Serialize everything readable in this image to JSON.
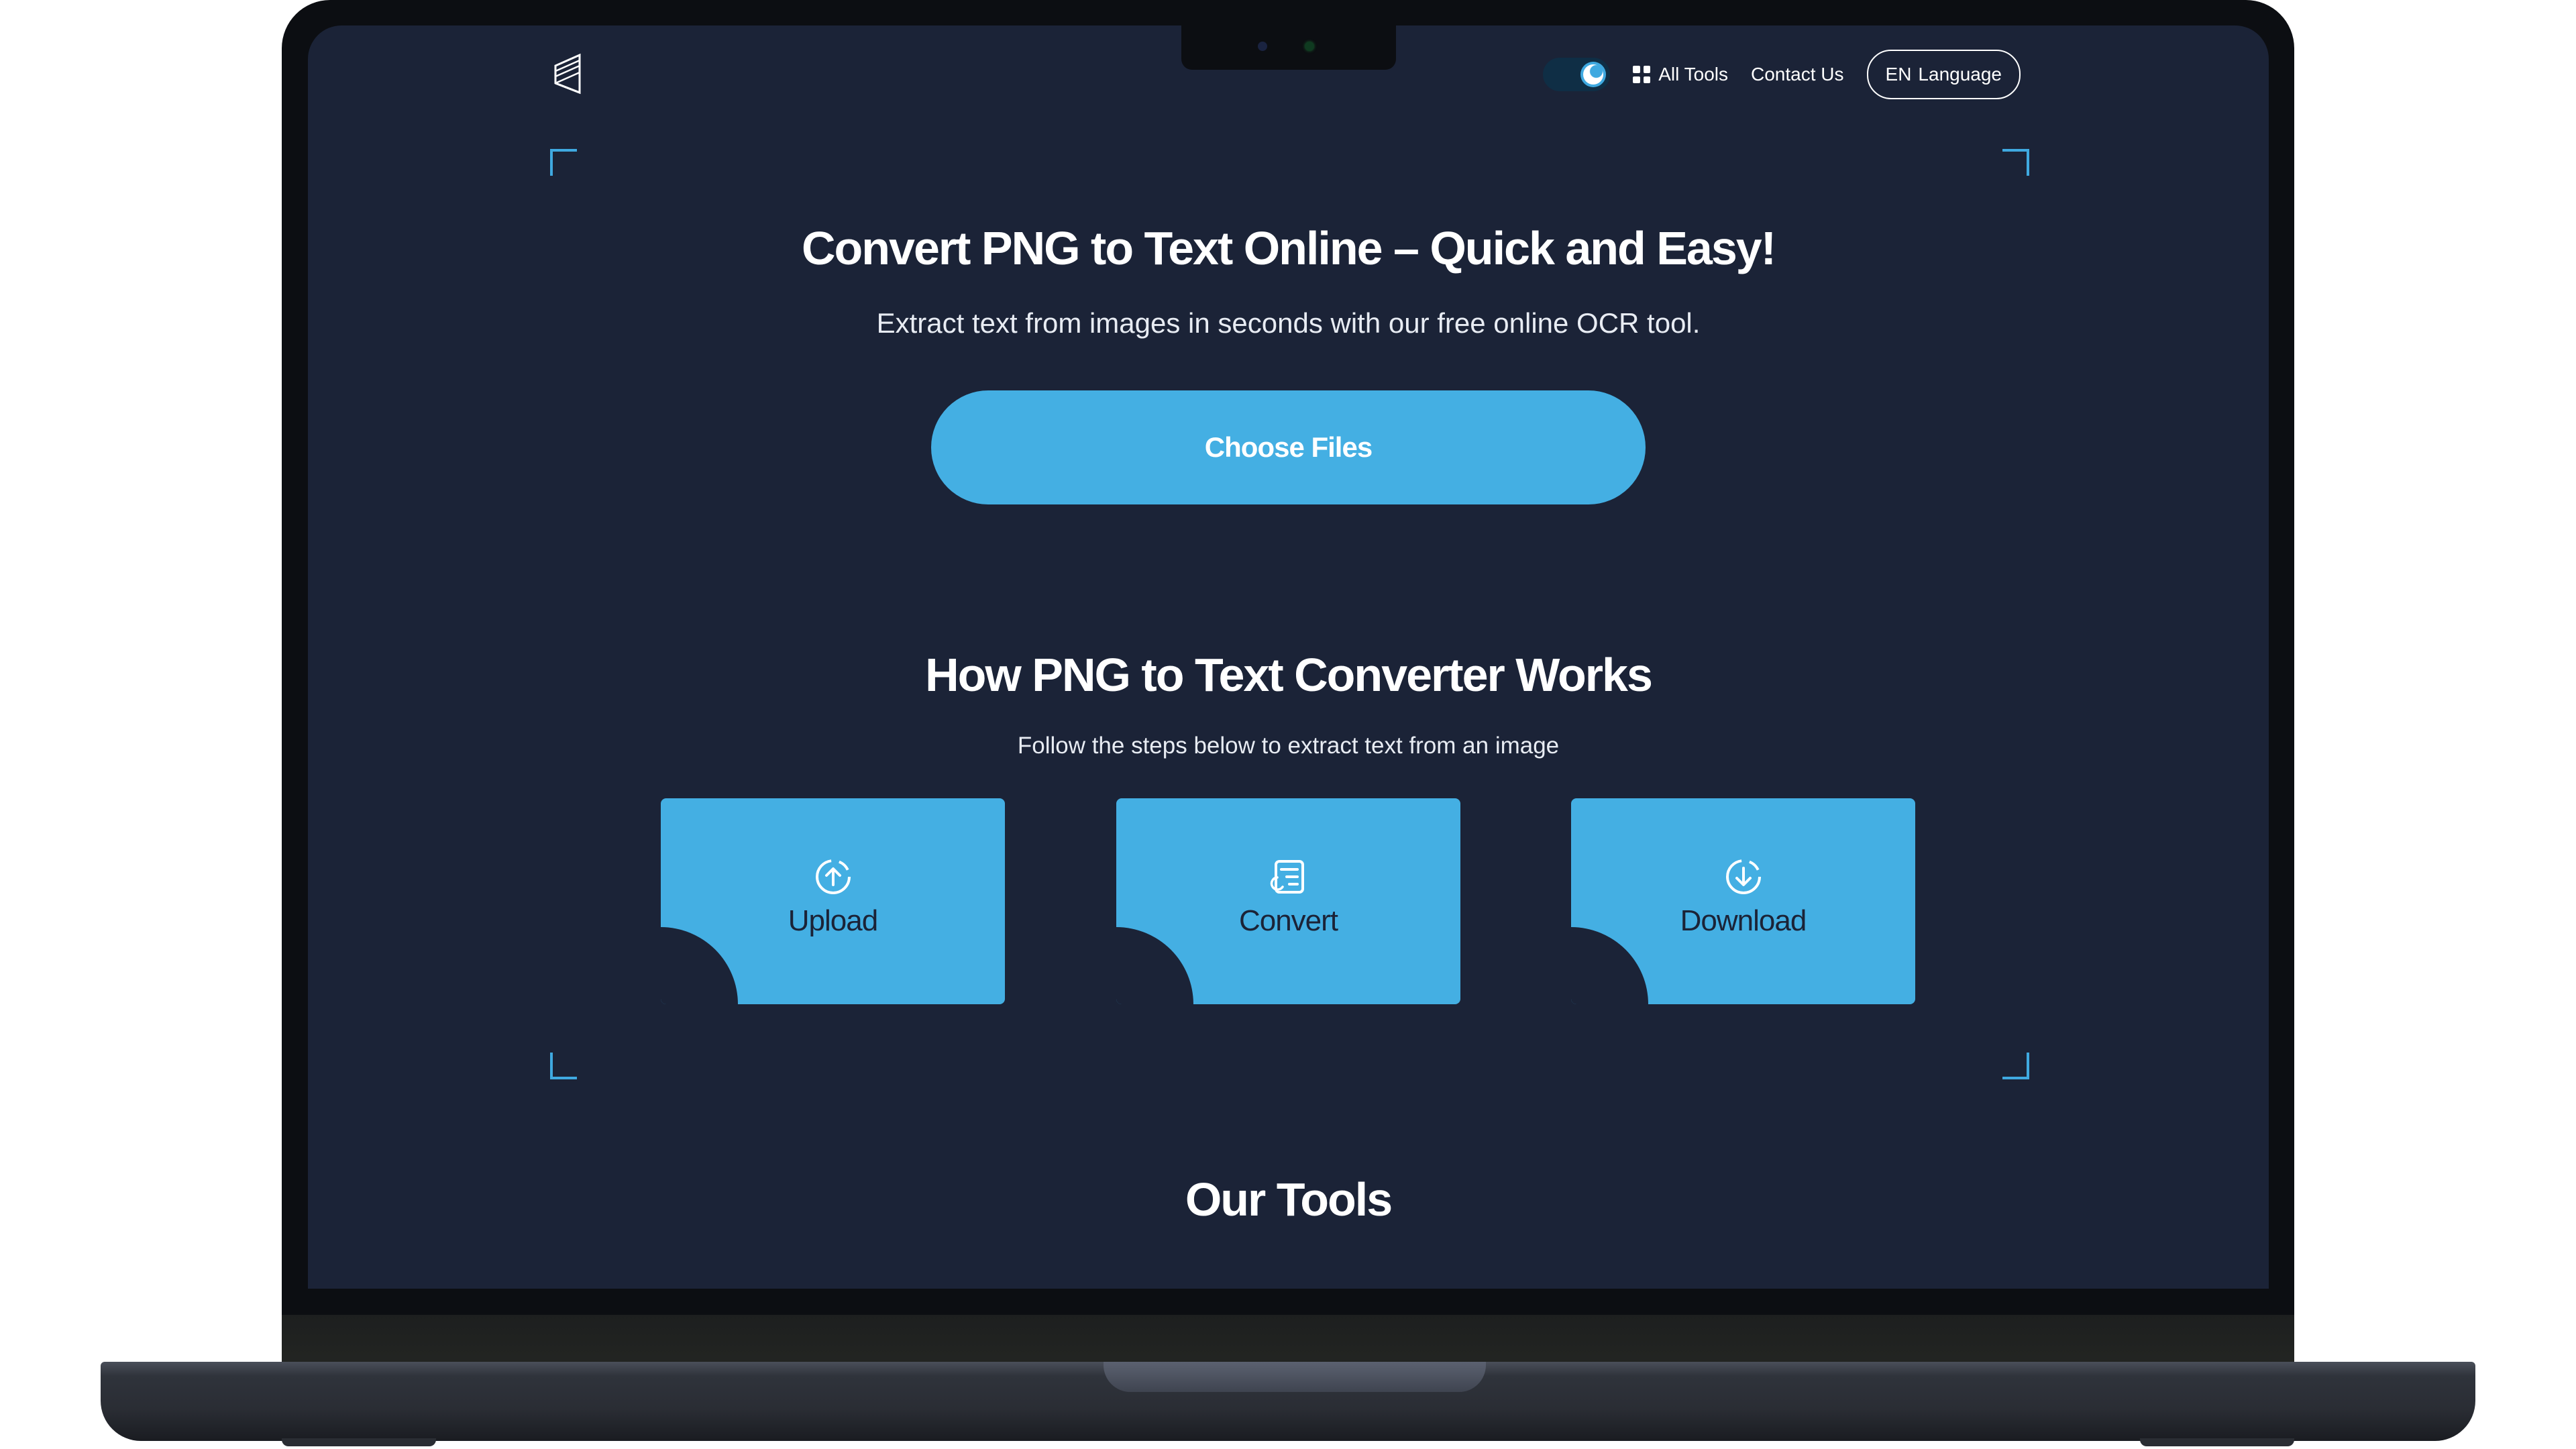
{
  "header": {
    "nav_all_tools": "All Tools",
    "nav_contact": "Contact Us",
    "lang_code": "EN",
    "lang_label": "Language"
  },
  "hero": {
    "title": "Convert PNG to Text Online – Quick and Easy!",
    "subtitle": "Extract text from images in seconds with our free online OCR tool.",
    "choose_button": "Choose Files"
  },
  "how": {
    "title": "How PNG to Text Converter Works",
    "subtitle": "Follow the steps below to extract text from an image",
    "steps": [
      {
        "label": "Upload",
        "icon": "upload-icon"
      },
      {
        "label": "Convert",
        "icon": "convert-icon"
      },
      {
        "label": "Download",
        "icon": "download-icon"
      }
    ]
  },
  "tools": {
    "title": "Our Tools"
  },
  "colors": {
    "background": "#1b2337",
    "accent": "#44afe3",
    "text": "#ffffff"
  }
}
